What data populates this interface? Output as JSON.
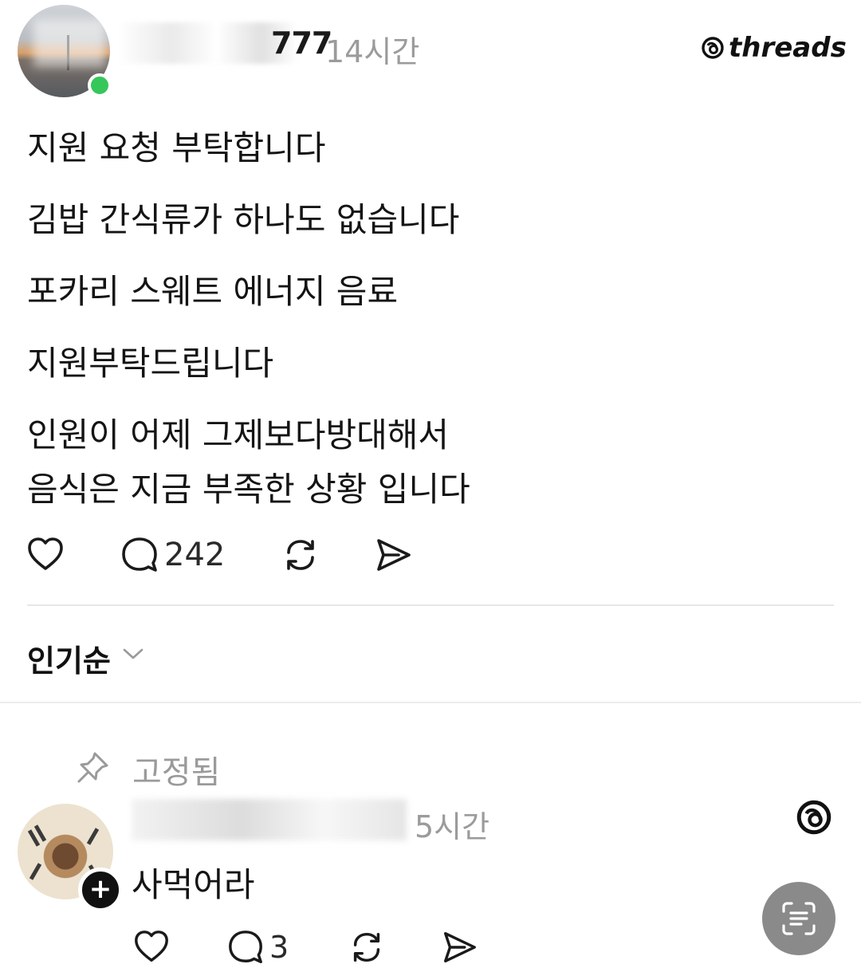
{
  "post": {
    "username": "777",
    "time": "14시간",
    "brand": "threads",
    "lines": [
      "지원 요청 부탁합니다",
      "김밥 간식류가 하나도 없습니다",
      "포카리 스웨트 에너지  음료",
      "지원부탁드립니다",
      "인원이 어제 그제보다방대해서",
      "음식은 지금 부족한 상황 입니다"
    ],
    "actions": {
      "like_icon": "heart-icon",
      "comment_icon": "comment-icon",
      "comment_count": "242",
      "repost_icon": "repost-icon",
      "share_icon": "send-icon"
    }
  },
  "sort": {
    "label": "인기순",
    "icon": "chevron-down-icon"
  },
  "pinned_reply": {
    "pinned_label": "고정됨",
    "time": "5시간",
    "text": "사먹어라",
    "follow_symbol": "+",
    "actions": {
      "comment_count": "3"
    }
  },
  "colors": {
    "online": "#35c759",
    "muted": "#9b9b9b",
    "scan_button": "#8a8a8a"
  }
}
